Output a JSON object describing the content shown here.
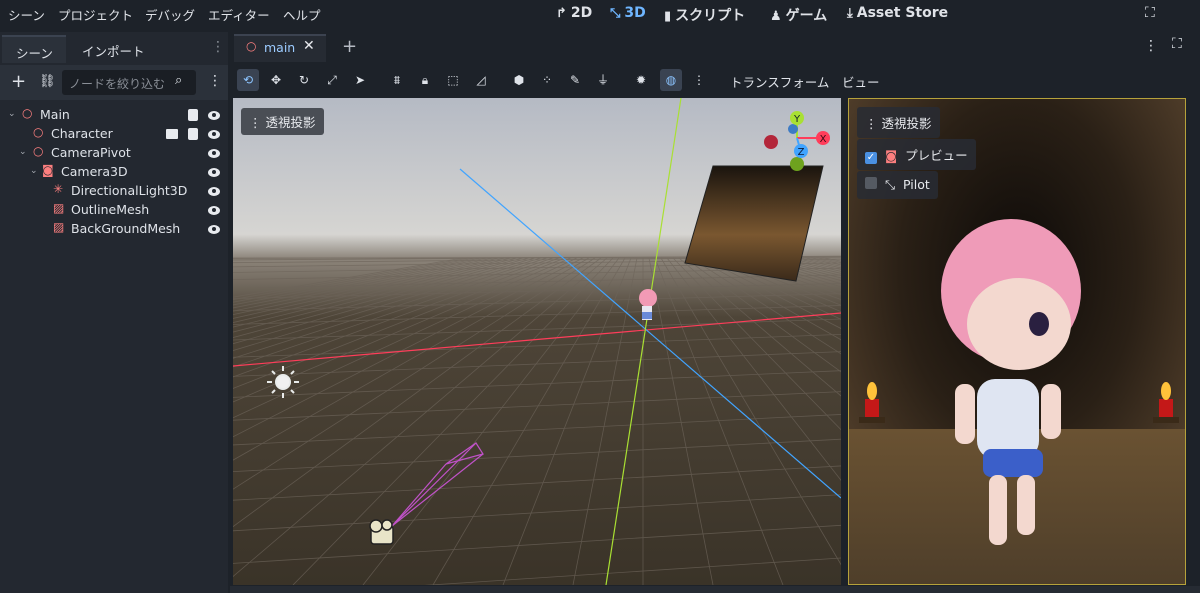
{
  "menu": [
    "シーン",
    "プロジェクト",
    "デバッグ",
    "エディター",
    "ヘルプ"
  ],
  "modes": [
    {
      "icon": "↱",
      "label": "2D"
    },
    {
      "icon": "⤡",
      "label": "3D"
    },
    {
      "icon": "▮",
      "label": "スクリプト"
    },
    {
      "icon": "♟",
      "label": "ゲーム"
    },
    {
      "icon": "⤓",
      "label": "Asset Store"
    }
  ],
  "active_mode": "3D",
  "dock": {
    "tabs": [
      "シーン",
      "インポート"
    ],
    "filter_placeholder": "ノードを絞り込む"
  },
  "tree": [
    {
      "name": "Main",
      "depth": 0,
      "icon": "node3d-icon",
      "expanded": true,
      "script": true
    },
    {
      "name": "Character",
      "depth": 1,
      "icon": "node3d-icon",
      "clapper": true,
      "script": true
    },
    {
      "name": "CameraPivot",
      "depth": 1,
      "icon": "node3d-icon",
      "expanded": true
    },
    {
      "name": "Camera3D",
      "depth": 2,
      "icon": "camera-icon",
      "expanded": true
    },
    {
      "name": "DirectionalLight3D",
      "depth": 3,
      "icon": "light-icon"
    },
    {
      "name": "OutlineMesh",
      "depth": 3,
      "icon": "mesh-icon"
    },
    {
      "name": "BackGroundMesh",
      "depth": 3,
      "icon": "mesh-icon"
    }
  ],
  "editor_tab": "main",
  "toolbar": {
    "transform_label": "トランスフォーム",
    "view_label": "ビュー"
  },
  "viewport": {
    "perspective_label": "透視投影",
    "gizmo": {
      "y": "Y",
      "x": "X",
      "z": "Z"
    }
  },
  "preview": {
    "perspective_label": "透視投影",
    "preview_label": "プレビュー",
    "preview_checked": true,
    "pilot_label": "Pilot",
    "pilot_checked": false
  },
  "colors": {
    "accent": "#6fb6ff",
    "node_red": "#fc7f7f",
    "x_axis": "#ff3d5a",
    "y_axis": "#a9e033",
    "z_axis": "#41a4ff",
    "preview_border": "#b6a23b"
  }
}
